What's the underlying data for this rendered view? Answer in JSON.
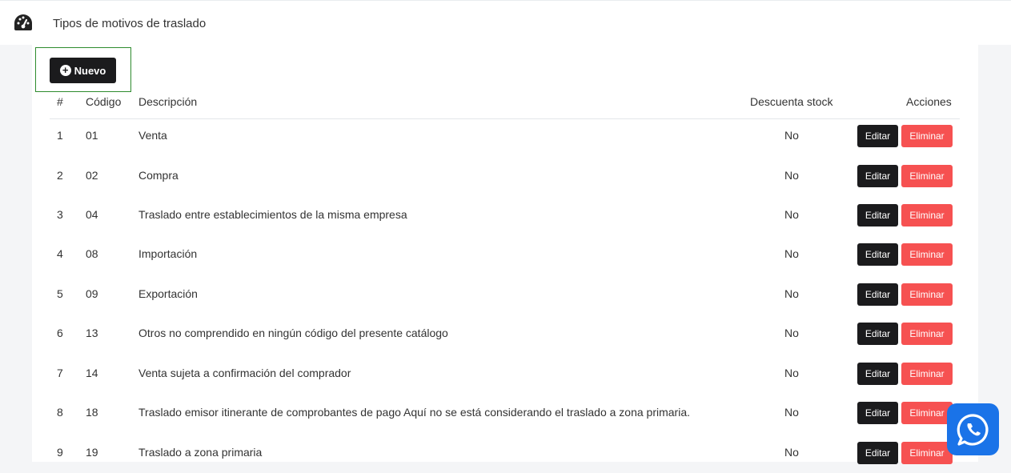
{
  "header": {
    "title": "Tipos de motivos de traslado",
    "icon": "dashboard-gauge-icon"
  },
  "toolbar": {
    "new_label": "Nuevo",
    "new_icon": "plus-circle-icon"
  },
  "table": {
    "columns": [
      "#",
      "Código",
      "Descripción",
      "Descuenta stock",
      "Acciones"
    ],
    "rows": [
      {
        "num": "1",
        "code": "01",
        "desc": "Venta",
        "stock": "No"
      },
      {
        "num": "2",
        "code": "02",
        "desc": "Compra",
        "stock": "No"
      },
      {
        "num": "3",
        "code": "04",
        "desc": "Traslado entre establecimientos de la misma empresa",
        "stock": "No"
      },
      {
        "num": "4",
        "code": "08",
        "desc": "Importación",
        "stock": "No"
      },
      {
        "num": "5",
        "code": "09",
        "desc": "Exportación",
        "stock": "No"
      },
      {
        "num": "6",
        "code": "13",
        "desc": "Otros no comprendido en ningún código del presente catálogo",
        "stock": "No"
      },
      {
        "num": "7",
        "code": "14",
        "desc": "Venta sujeta a confirmación del comprador",
        "stock": "No"
      },
      {
        "num": "8",
        "code": "18",
        "desc": "Traslado emisor itinerante de comprobantes de pago Aquí no se está considerando el traslado a zona primaria.",
        "stock": "No"
      },
      {
        "num": "9",
        "code": "19",
        "desc": "Traslado a zona primaria",
        "stock": "No"
      }
    ],
    "edit_label": "Editar",
    "delete_label": "Eliminar"
  },
  "colors": {
    "dark_button": "#1b1b1d",
    "delete_button": "#f65151",
    "whatsapp_button": "#1a73e8"
  },
  "floating": {
    "icon": "whatsapp-icon"
  }
}
